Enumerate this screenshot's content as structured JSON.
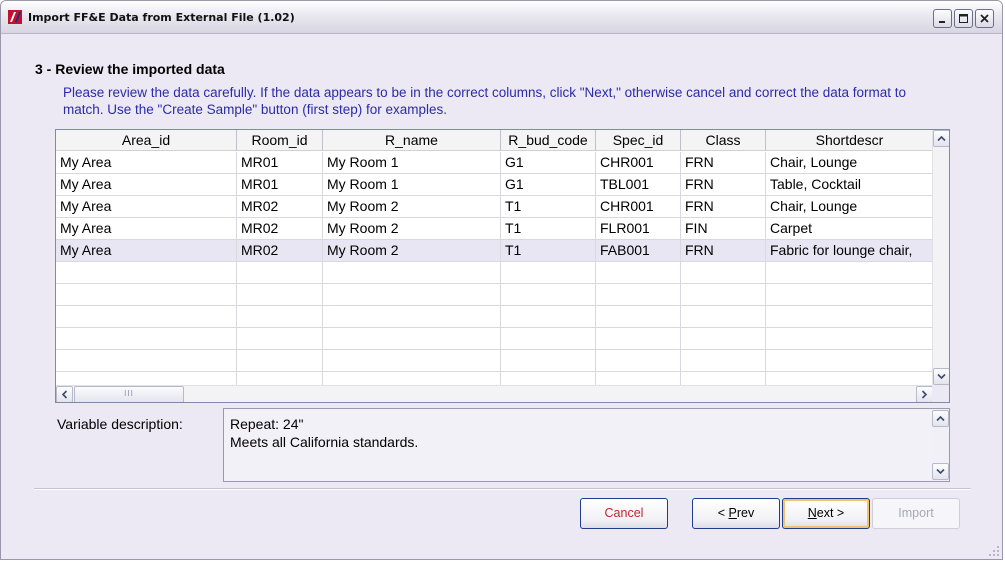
{
  "window": {
    "title": "Import FF&E Data from External File (1.02)"
  },
  "step": {
    "title": "3 - Review the imported data",
    "instructions": "Please review the data carefully. If the data appears to be in the correct columns, click \"Next,\" otherwise cancel and correct the data format to match. Use the \"Create Sample\" button (first step) for examples."
  },
  "grid": {
    "columns": [
      "Area_id",
      "Room_id",
      "R_name",
      "R_bud_code",
      "Spec_id",
      "Class",
      "Shortdescr"
    ],
    "rows": [
      [
        "My Area",
        "MR01",
        "My Room 1",
        "G1",
        "CHR001",
        "FRN",
        "Chair, Lounge"
      ],
      [
        "My Area",
        "MR01",
        "My Room 1",
        "G1",
        "TBL001",
        "FRN",
        "Table, Cocktail"
      ],
      [
        "My Area",
        "MR02",
        "My Room 2",
        "T1",
        "CHR001",
        "FRN",
        "Chair, Lounge"
      ],
      [
        "My Area",
        "MR02",
        "My Room 2",
        "T1",
        "FLR001",
        "FIN",
        "Carpet"
      ],
      [
        "My Area",
        "MR02",
        "My Room 2",
        "T1",
        "FAB001",
        "FRN",
        "Fabric for lounge chair,"
      ]
    ],
    "selected_row": 4,
    "hscroll_thumb_grip": "III"
  },
  "variable_description": {
    "label": "Variable description:",
    "text": "Repeat: 24\"\nMeets all California standards."
  },
  "buttons": {
    "cancel": "Cancel",
    "prev_prefix": "< ",
    "prev_mnemonic": "P",
    "prev_rest": "rev",
    "next_mnemonic": "N",
    "next_rest": "ext >",
    "import": "Import"
  },
  "colors": {
    "window_bg": "#ece9f5",
    "instruction_text": "#2b2ba8",
    "cancel_text": "#c0272d",
    "selected_row": "#e8e6f3",
    "disabled_text": "#a8a8b8"
  },
  "icons": {
    "app": "ffe-app-icon",
    "minimize": "minimize-icon",
    "maximize": "maximize-icon",
    "close": "close-icon"
  }
}
